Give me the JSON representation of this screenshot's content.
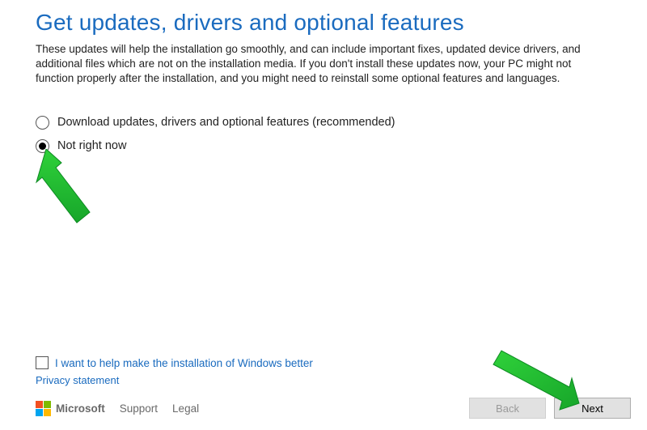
{
  "header": {
    "title": "Get updates, drivers and optional features",
    "description": "These updates will help the installation go smoothly, and can include important fixes, updated device drivers, and additional files which are not on the installation media. If you don't install these updates now, your PC might not function properly after the installation, and you might need to reinstall some optional features and languages."
  },
  "options": {
    "download_label": "Download updates, drivers and optional features (recommended)",
    "not_now_label": "Not right now"
  },
  "feedback": {
    "checkbox_label": "I want to help make the installation of Windows better",
    "privacy_label": "Privacy statement"
  },
  "brand": {
    "name": "Microsoft",
    "support": "Support",
    "legal": "Legal"
  },
  "buttons": {
    "back": "Back",
    "next": "Next"
  }
}
